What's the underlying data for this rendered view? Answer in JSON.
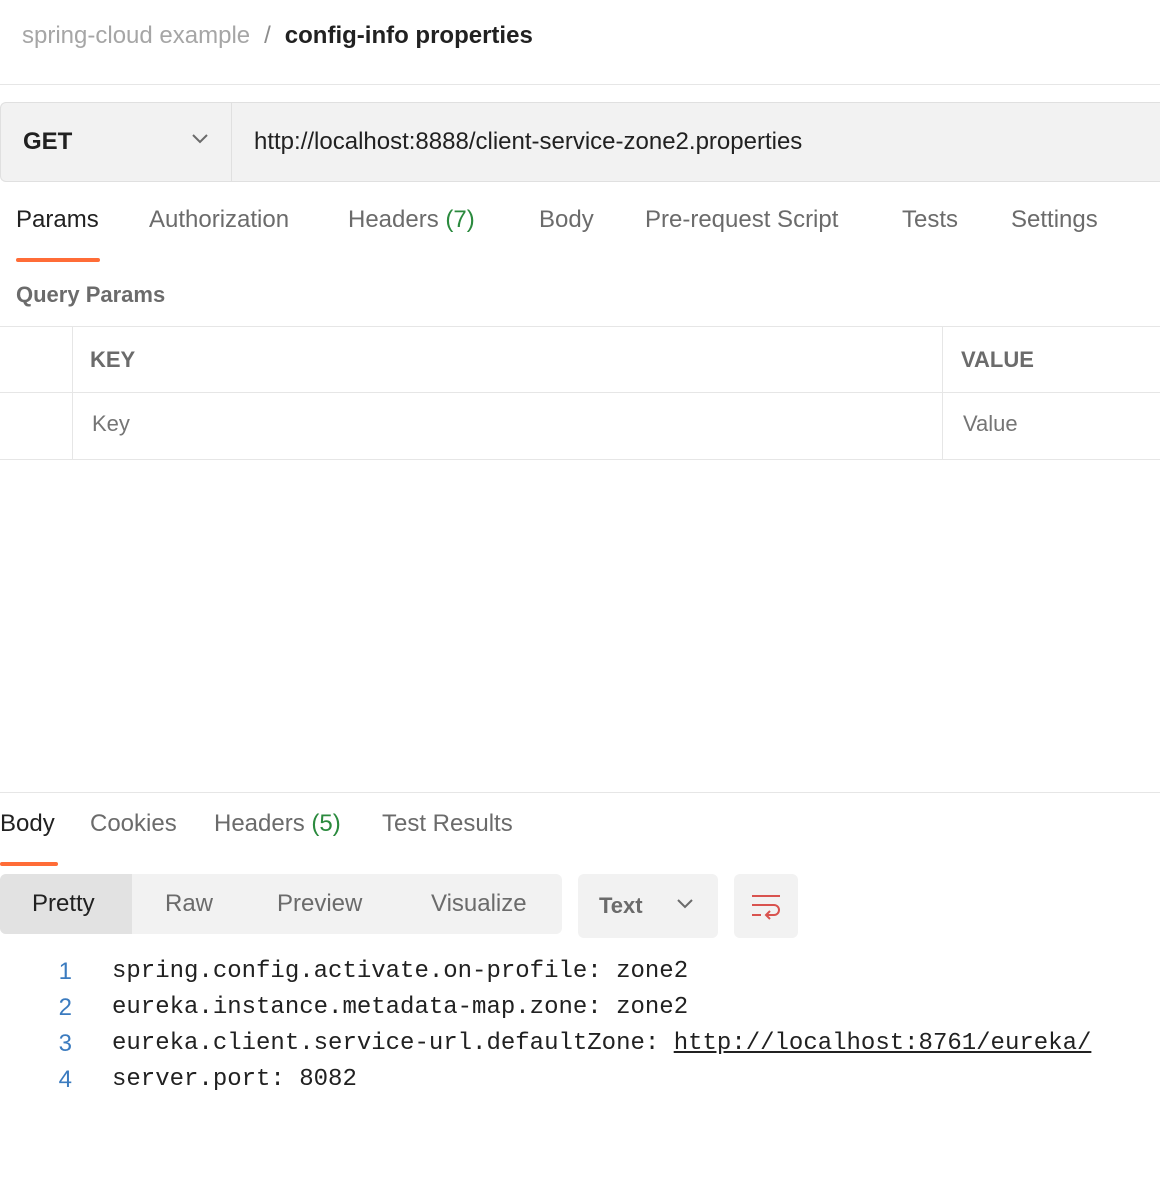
{
  "breadcrumb": {
    "parent": "spring-cloud example",
    "separator": "/",
    "current": "config-info properties"
  },
  "request": {
    "method": "GET",
    "url": "http://localhost:8888/client-service-zone2.properties"
  },
  "request_tabs": [
    {
      "label": "Params",
      "count": ""
    },
    {
      "label": "Authorization",
      "count": ""
    },
    {
      "label": "Headers",
      "count": "(7)"
    },
    {
      "label": "Body",
      "count": ""
    },
    {
      "label": "Pre-request Script",
      "count": ""
    },
    {
      "label": "Tests",
      "count": ""
    },
    {
      "label": "Settings",
      "count": ""
    }
  ],
  "active_request_tab": "Params",
  "query_params": {
    "title": "Query Params",
    "columns": [
      "KEY",
      "VALUE"
    ],
    "key_placeholder": "Key",
    "value_placeholder": "Value"
  },
  "response_tabs": [
    {
      "label": "Body",
      "count": ""
    },
    {
      "label": "Cookies",
      "count": ""
    },
    {
      "label": "Headers",
      "count": "(5)"
    },
    {
      "label": "Test Results",
      "count": ""
    }
  ],
  "active_response_tab": "Body",
  "view_modes": [
    "Pretty",
    "Raw",
    "Preview",
    "Visualize"
  ],
  "active_view_mode": "Pretty",
  "format": "Text",
  "code_lines": [
    {
      "num": "1",
      "text": "spring.config.activate.on-profile: zone2",
      "link": ""
    },
    {
      "num": "2",
      "text": "eureka.instance.metadata-map.zone: zone2",
      "link": ""
    },
    {
      "num": "3",
      "text": "eureka.client.service-url.defaultZone: ",
      "link": "http://localhost:8761/eureka/"
    },
    {
      "num": "4",
      "text": "server.port: 8082",
      "link": ""
    }
  ],
  "colors": {
    "accent": "#ff6c37",
    "count_green": "#2b8a3e",
    "line_number_blue": "#3b7bbf"
  },
  "icons": {
    "method_dropdown": "chevron-down-icon",
    "format_dropdown": "chevron-down-icon",
    "wrap_toggle": "wrap-lines-icon"
  }
}
